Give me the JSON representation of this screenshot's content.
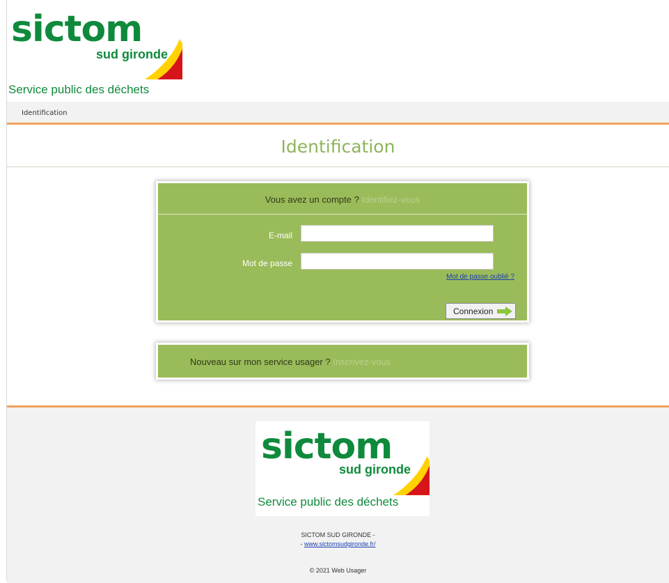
{
  "header": {
    "logo": {
      "brand": "sictom",
      "sub": "sud gironde",
      "tagline": "Service public des déchets"
    },
    "breadcrumb": "Identification"
  },
  "page": {
    "title": "Identification"
  },
  "login": {
    "question": "Vous avez un compte ?",
    "cta": "Identifiez-vous",
    "email_label": "E-mail",
    "email_value": "",
    "password_label": "Mot de passe",
    "password_value": "",
    "forgot_link": "Mot de passe oublié ?",
    "submit_label": "Connexion"
  },
  "signup": {
    "question": "Nouveau sur mon service usager ?",
    "cta": "Inscrivez-vous"
  },
  "footer": {
    "logo": {
      "brand": "sictom",
      "sub": "sud gironde",
      "tagline": "Service public des déchets"
    },
    "org_name": "SICTOM SUD GIRONDE -",
    "link_prefix": "- ",
    "website": "www.sictomsudgironde.fr/",
    "copyright": "© 2021 Web Usager"
  },
  "colors": {
    "brand_green": "#0f8a3c",
    "panel_green": "#9abb59",
    "title_green": "#8db55a",
    "accent_orange": "#f0a25a",
    "logo_red": "#d7141a",
    "logo_yellow": "#ffd200"
  }
}
